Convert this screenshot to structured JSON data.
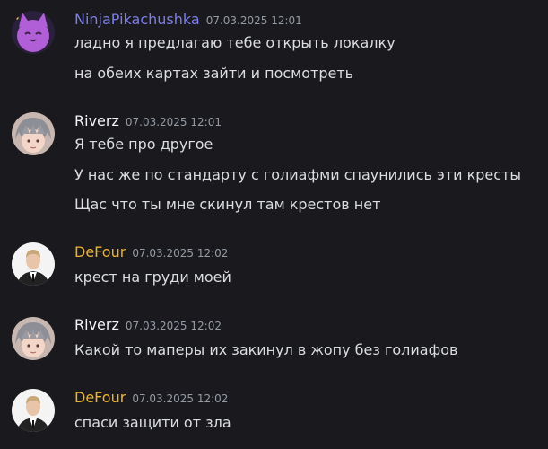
{
  "colors": {
    "background": "#1a1a1e",
    "ninja": "#7c7fe6",
    "riverz": "#f2f3f5",
    "defour": "#f0b232",
    "timestamp": "#949ba4"
  },
  "messages": [
    {
      "author": "NinjaPikachushka",
      "timestamp": "07.03.2025 12:01",
      "avatar_icon": "purple-cat-avatar-icon",
      "lines": [
        "ладно я предлагаю тебе открыть локалку",
        "на обеих картах зайти и посмотреть"
      ]
    },
    {
      "author": "Riverz",
      "timestamp": "07.03.2025 12:01",
      "avatar_icon": "anime-boy-avatar-icon",
      "lines": [
        "Я тебе про другое",
        "У нас же по стандарту с голиафми спаунились эти кресты",
        "Щас что ты мне скинул там крестов нет"
      ]
    },
    {
      "author": "DeFour",
      "timestamp": "07.03.2025 12:02",
      "avatar_icon": "person-in-suit-avatar-icon",
      "lines": [
        "крест на груди моей"
      ]
    },
    {
      "author": "Riverz",
      "timestamp": "07.03.2025 12:02",
      "avatar_icon": "anime-boy-avatar-icon",
      "lines": [
        "Какой то маперы их закинул в жопу без голиафов"
      ]
    },
    {
      "author": "DeFour",
      "timestamp": "07.03.2025 12:02",
      "avatar_icon": "person-in-suit-avatar-icon",
      "lines": [
        "спаси защити от зла"
      ]
    }
  ]
}
